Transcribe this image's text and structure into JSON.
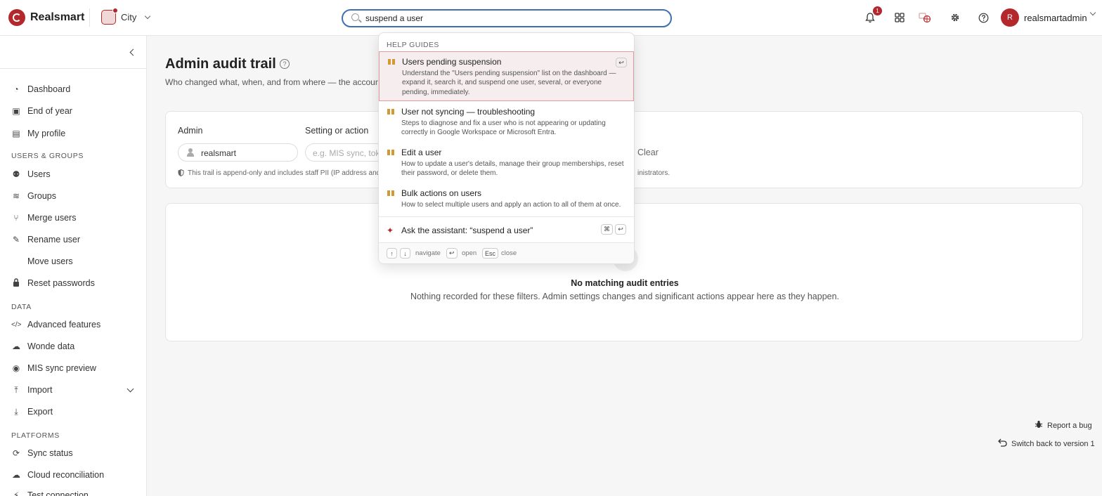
{
  "app": {
    "name": "Realsmart",
    "org": "City"
  },
  "search": {
    "value": "suspend a user"
  },
  "header": {
    "notification_count": "1",
    "avatar_initial": "R",
    "username": "realsmartadmin"
  },
  "sidebar": {
    "items_top": [
      {
        "label": "Dashboard",
        "icon": "dashboard-icon",
        "glyph": "◔"
      },
      {
        "label": "End of year",
        "icon": "calendar-icon",
        "glyph": "▣"
      },
      {
        "label": "My profile",
        "icon": "profile-card-icon",
        "glyph": "▤"
      }
    ],
    "section_users": "USERS & GROUPS",
    "items_users": [
      {
        "label": "Users",
        "icon": "users-icon",
        "glyph": "⚉"
      },
      {
        "label": "Groups",
        "icon": "layers-icon",
        "glyph": "≋"
      },
      {
        "label": "Merge users",
        "icon": "merge-icon",
        "glyph": "⑂"
      },
      {
        "label": "Rename user",
        "icon": "user-edit-icon",
        "glyph": "✎"
      },
      {
        "label": "Move users",
        "icon": "",
        "glyph": ""
      },
      {
        "label": "Reset passwords",
        "icon": "lock-icon",
        "glyph": "🔒"
      }
    ],
    "section_data": "DATA",
    "items_data": [
      {
        "label": "Advanced features",
        "icon": "code-icon",
        "glyph": "</>"
      },
      {
        "label": "Wonde data",
        "icon": "cloud-download-icon",
        "glyph": "☁"
      },
      {
        "label": "MIS sync preview",
        "icon": "eye-icon",
        "glyph": "◉"
      },
      {
        "label": "Import",
        "icon": "upload-icon",
        "glyph": "⤒"
      },
      {
        "label": "Export",
        "icon": "download-icon",
        "glyph": "⤓"
      }
    ],
    "section_platforms": "PLATFORMS",
    "items_platforms": [
      {
        "label": "Sync status",
        "icon": "sync-icon",
        "glyph": "⟳"
      },
      {
        "label": "Cloud reconciliation",
        "icon": "cloud-upload-icon",
        "glyph": "☁"
      },
      {
        "label": "Test connection",
        "icon": "plug-icon",
        "glyph": "⚡"
      }
    ]
  },
  "main": {
    "title": "Admin audit trail",
    "subtitle": "Who changed what, when, and from where — the accounta",
    "filters": {
      "admin_label": "Admin",
      "admin_value": "realsmart",
      "setting_label": "Setting or action",
      "setting_placeholder": "e.g. MIS sync, toke",
      "clear_label": "Clear",
      "note_left": "This trail is append-only and includes staff PII (IP address and",
      "note_right": "inistrators."
    },
    "empty": {
      "title": "No matching audit entries",
      "description": "Nothing recorded for these filters. Admin settings changes and significant actions appear here as they happen."
    },
    "report_bug": "Report a bug",
    "switch_version": "Switch back to version 1"
  },
  "dropdown": {
    "heading": "HELP GUIDES",
    "items": [
      {
        "title": "Users pending suspension",
        "description": "Understand the \"Users pending suspension\" list on the dashboard — expand it, search it, and suspend one user, several, or everyone pending, immediately."
      },
      {
        "title": "User not syncing — troubleshooting",
        "description": "Steps to diagnose and fix a user who is not appearing or updating correctly in Google Workspace or Microsoft Entra."
      },
      {
        "title": "Edit a user",
        "description": "How to update a user's details, manage their group memberships, reset their password, or delete them."
      },
      {
        "title": "Bulk actions on users",
        "description": "How to select multiple users and apply an action to all of them at once."
      }
    ],
    "ask_label": "Ask the assistant: “suspend a user”",
    "keys": {
      "cmd": "⌘",
      "enter": "↩",
      "up": "↑",
      "down": "↓",
      "esc": "Esc"
    },
    "footer": {
      "navigate": "navigate",
      "open": "open",
      "close": "close"
    }
  }
}
